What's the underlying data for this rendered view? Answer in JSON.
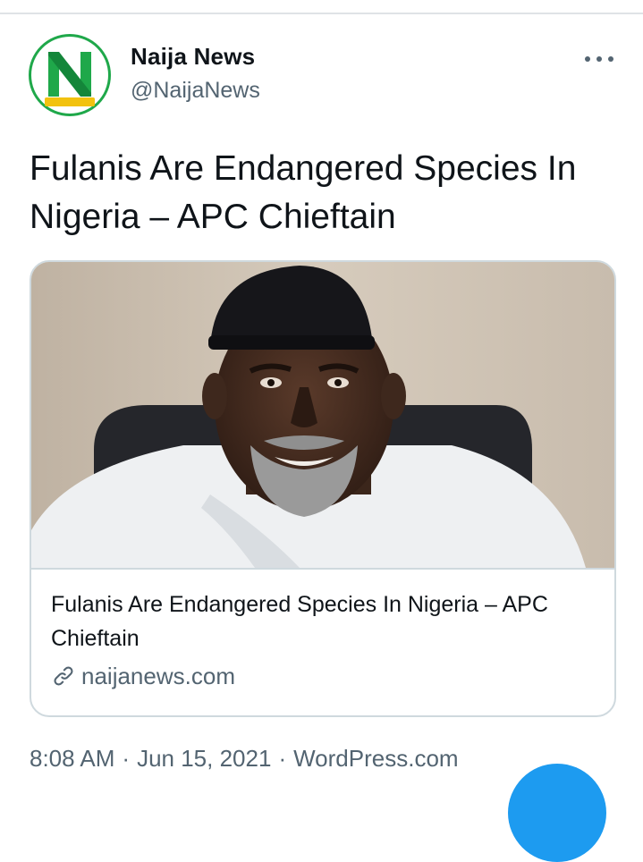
{
  "tweet": {
    "author": {
      "display_name": "Naija News",
      "handle": "@NaijaNews",
      "avatar_caption": "NaijaNews"
    },
    "text": "Fulanis Are Endangered Species In Nigeria – APC Chieftain",
    "card": {
      "title": "Fulanis Are Endangered Species In Nigeria – APC Chieftain",
      "domain": "naijanews.com"
    },
    "meta": {
      "time": "8:08 AM",
      "separator": "·",
      "date": "Jun 15, 2021",
      "source": "WordPress.com"
    }
  },
  "icons": {
    "more": "more-options-icon",
    "link": "link-icon"
  },
  "colors": {
    "text_primary": "#0f1419",
    "text_secondary": "#536471",
    "border": "#cfd9de",
    "accent": "#1d9bf0",
    "brand_green": "#1fa84a"
  }
}
